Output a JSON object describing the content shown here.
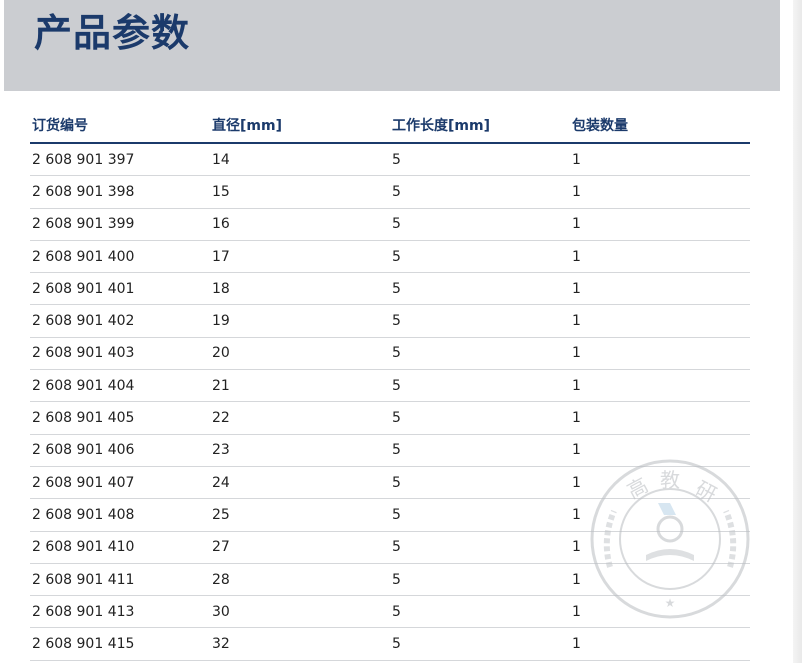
{
  "header": {
    "title": "产品参数"
  },
  "table": {
    "columns": [
      "订货编号",
      "直径[mm]",
      "工作长度[mm]",
      "包装数量"
    ],
    "rows": [
      [
        "2 608 901 397",
        "14",
        "5",
        "1"
      ],
      [
        "2 608 901 398",
        "15",
        "5",
        "1"
      ],
      [
        "2 608 901 399",
        "16",
        "5",
        "1"
      ],
      [
        "2 608 901 400",
        "17",
        "5",
        "1"
      ],
      [
        "2 608 901 401",
        "18",
        "5",
        "1"
      ],
      [
        "2 608 901 402",
        "19",
        "5",
        "1"
      ],
      [
        "2 608 901 403",
        "20",
        "5",
        "1"
      ],
      [
        "2 608 901 404",
        "21",
        "5",
        "1"
      ],
      [
        "2 608 901 405",
        "22",
        "5",
        "1"
      ],
      [
        "2 608 901 406",
        "23",
        "5",
        "1"
      ],
      [
        "2 608 901 407",
        "24",
        "5",
        "1"
      ],
      [
        "2 608 901 408",
        "25",
        "5",
        "1"
      ],
      [
        "2 608 901 410",
        "27",
        "5",
        "1"
      ],
      [
        "2 608 901 411",
        "28",
        "5",
        "1"
      ],
      [
        "2 608 901 413",
        "30",
        "5",
        "1"
      ],
      [
        "2 608 901 415",
        "32",
        "5",
        "1"
      ]
    ]
  },
  "watermark": {
    "text": "高教研",
    "icon": "seal-stamp-icon"
  },
  "colors": {
    "title": "#1b3a6b",
    "header_band": "#cbcdd1",
    "rule": "#1b3a6b"
  }
}
